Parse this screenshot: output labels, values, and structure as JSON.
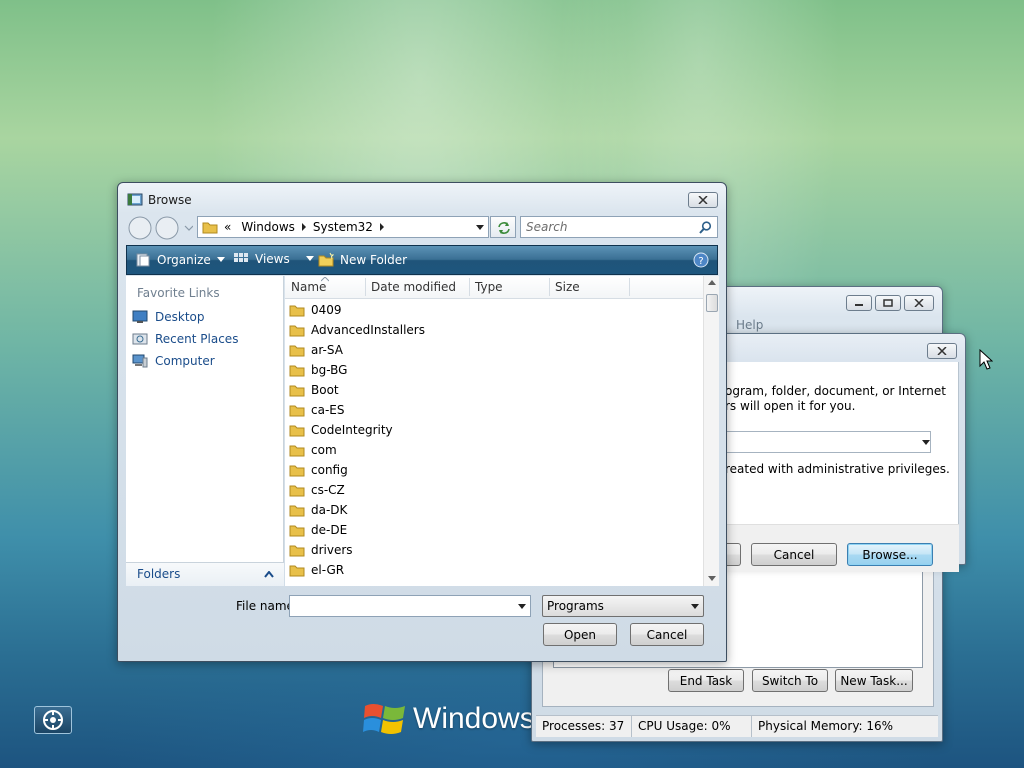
{
  "desktop": {
    "os_wordmark": "Windows V"
  },
  "task_manager": {
    "menu_help": "Help",
    "buttons": {
      "end_task": "End Task",
      "switch_to": "Switch To",
      "new_task": "New Task..."
    },
    "status": {
      "processes": "Processes: 37",
      "cpu": "CPU Usage: 0%",
      "memory": "Physical Memory: 16%"
    }
  },
  "run_dialog": {
    "line1": "ogram, folder, document, or Internet",
    "line2": "rs will open it for you.",
    "admin_note": "reated with administrative privileges.",
    "buttons": {
      "cancel": "Cancel",
      "browse": "Browse..."
    }
  },
  "browse_dialog": {
    "title": "Browse",
    "breadcrumb": {
      "chevrons": "«",
      "seg1": "Windows",
      "seg2": "System32"
    },
    "search_placeholder": "Search",
    "toolbar": {
      "organize": "Organize",
      "views": "Views",
      "new_folder": "New Folder"
    },
    "nav": {
      "header": "Favorite Links",
      "links": [
        "Desktop",
        "Recent Places",
        "Computer"
      ],
      "folders_label": "Folders"
    },
    "columns": [
      "Name",
      "Date modified",
      "Type",
      "Size"
    ],
    "files": [
      "0409",
      "AdvancedInstallers",
      "ar-SA",
      "bg-BG",
      "Boot",
      "ca-ES",
      "CodeIntegrity",
      "com",
      "config",
      "cs-CZ",
      "da-DK",
      "de-DE",
      "drivers",
      "el-GR"
    ],
    "file_name_label": "File name:",
    "file_name_value": "",
    "file_type_selected": "Programs",
    "buttons": {
      "open": "Open",
      "cancel": "Cancel"
    }
  },
  "colors": {
    "toolbar_blue": "#2b5f86",
    "link_blue": "#1a4c8a",
    "folder_yellow": "#e8c04a"
  }
}
